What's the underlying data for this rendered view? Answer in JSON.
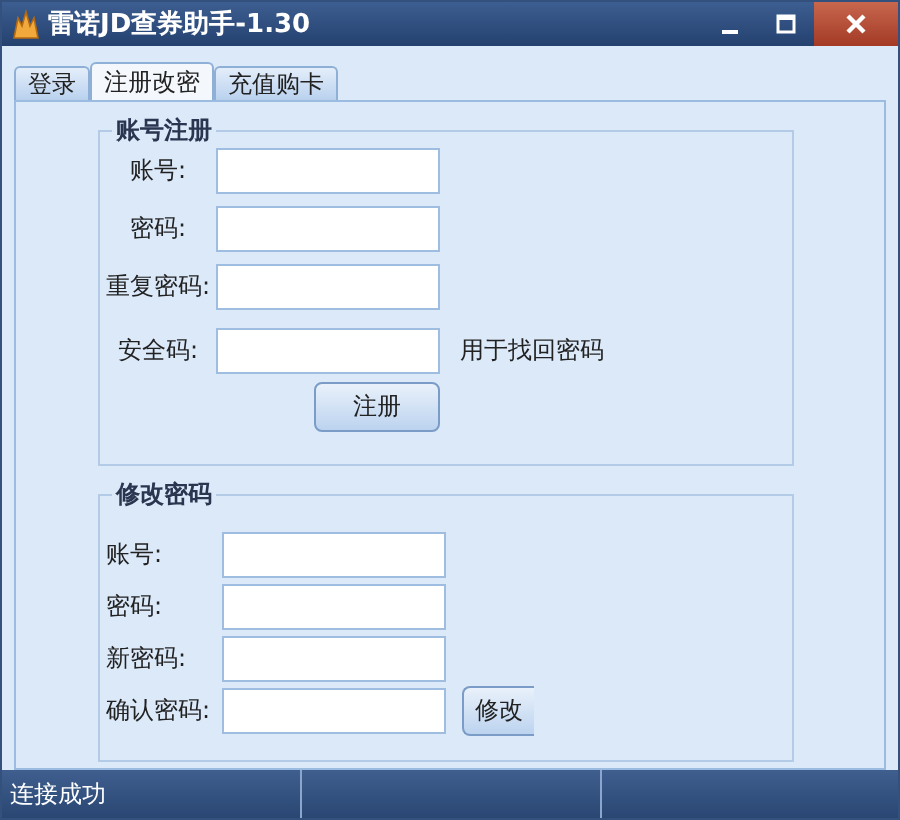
{
  "window": {
    "title": "雷诺JD查券助手-1.30"
  },
  "tabs": [
    {
      "label": "登录",
      "selected": false
    },
    {
      "label": "注册改密",
      "selected": true
    },
    {
      "label": "充值购卡",
      "selected": false
    }
  ],
  "register": {
    "title": "账号注册",
    "fields": [
      {
        "label": "账号:"
      },
      {
        "label": "密码:"
      },
      {
        "label": "重复密码:"
      },
      {
        "label": "安全码:",
        "hint": "用于找回密码"
      }
    ],
    "button": "注册"
  },
  "change_password": {
    "title": "修改密码",
    "fields": [
      {
        "label": "账号:"
      },
      {
        "label": "密码:"
      },
      {
        "label": "新密码:"
      },
      {
        "label": "确认密码:"
      }
    ],
    "button": "修改"
  },
  "status_bar": {
    "text": "连接成功"
  }
}
